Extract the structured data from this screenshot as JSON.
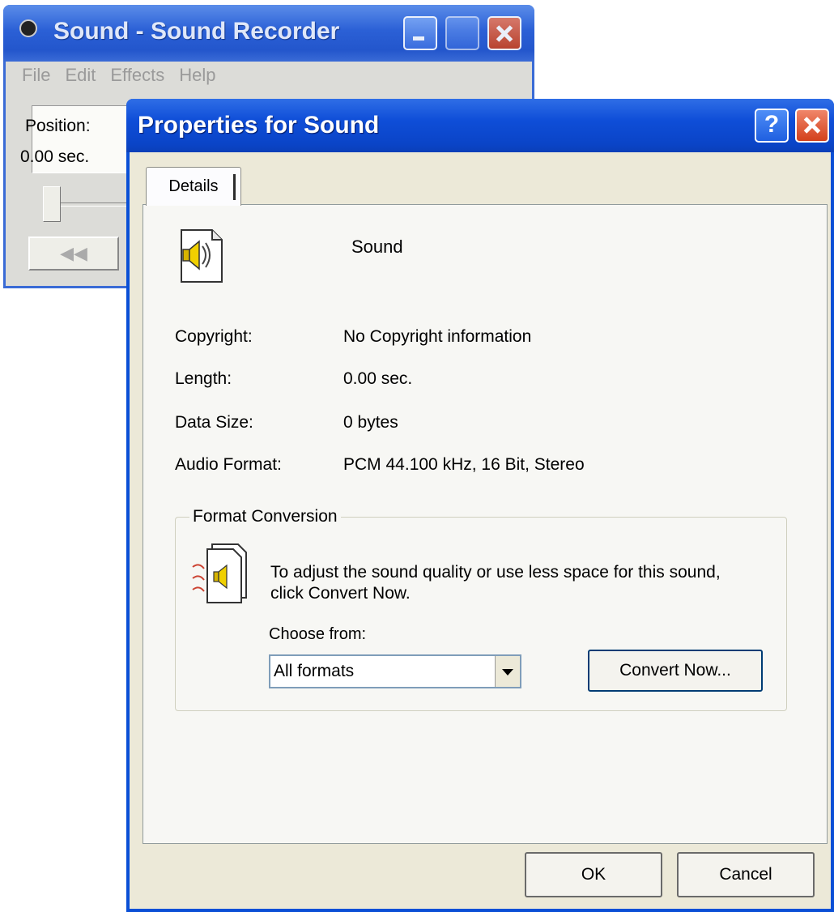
{
  "recorder": {
    "title": "Sound - Sound Recorder",
    "menu": [
      "File",
      "Edit",
      "Effects",
      "Help"
    ],
    "position_label": "Position:",
    "position_value": "0.00 sec."
  },
  "dialog": {
    "title": "Properties for Sound",
    "tab": "Details",
    "file_name": "Sound",
    "properties": [
      {
        "label": "Copyright:",
        "value": "No Copyright information"
      },
      {
        "label": "Length:",
        "value": "0.00 sec."
      },
      {
        "label": "Data Size:",
        "value": "0 bytes"
      },
      {
        "label": "Audio Format:",
        "value": "PCM 44.100 kHz, 16 Bit, Stereo"
      }
    ],
    "format_conversion": {
      "legend": "Format Conversion",
      "description": "To adjust the sound quality or use less space for this sound, click Convert Now.",
      "choose_label": "Choose from:",
      "choose_value": "All formats",
      "convert_button": "Convert Now..."
    },
    "ok_button": "OK",
    "cancel_button": "Cancel"
  },
  "icons": {
    "recorder_app": "sound-recorder-icon",
    "help": "help-icon",
    "close": "close-icon",
    "file": "sound-file-icon",
    "convert": "convert-sound-icon"
  }
}
